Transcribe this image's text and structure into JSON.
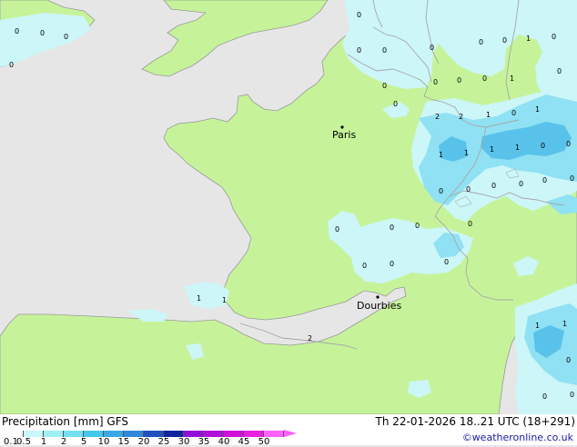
{
  "legend": {
    "title": "Precipitation [mm]",
    "model": "GFS",
    "ticks": [
      "0.1",
      "0.5",
      "1",
      "2",
      "5",
      "10",
      "15",
      "20",
      "25",
      "30",
      "35",
      "40",
      "45",
      "50"
    ],
    "colors": [
      "#ffffff",
      "#c8f8fa",
      "#9ef0f5",
      "#72e0f0",
      "#46c8ee",
      "#3aa8e4",
      "#2e88dc",
      "#2050c0",
      "#1024a0",
      "#9010d8",
      "#b010dc",
      "#d010d8",
      "#e820e0",
      "#ff60ff"
    ]
  },
  "valid_time": "Th 22-01-2026 18..21 UTC (18+291)",
  "credit": "©weatheronline.co.uk",
  "map": {
    "colors": {
      "sea": "#e6e6e6",
      "land": "#c6f39a",
      "precip_light": "#ccf6f8",
      "precip_medium": "#8fe1f3",
      "precip_heavy": "#59c2eb",
      "border": "#a7a7a7",
      "coast": "#999999"
    },
    "cities": [
      {
        "name": "Paris"
      },
      {
        "name": "Dourbies"
      }
    ],
    "values": [
      "0",
      "0",
      "0",
      "0",
      "0",
      "0",
      "0",
      "0",
      "0",
      "0",
      "0",
      "0",
      "0",
      "0",
      "1",
      "0",
      "0",
      "0",
      "1",
      "2",
      "2",
      "1",
      "0",
      "1",
      "1",
      "1",
      "1",
      "1",
      "0",
      "0",
      "0",
      "0",
      "0",
      "0",
      "0",
      "0",
      "0",
      "0",
      "0",
      "0",
      "0",
      "0",
      "0",
      "1",
      "1",
      "1",
      "1",
      "2",
      "0",
      "0",
      "0"
    ]
  }
}
